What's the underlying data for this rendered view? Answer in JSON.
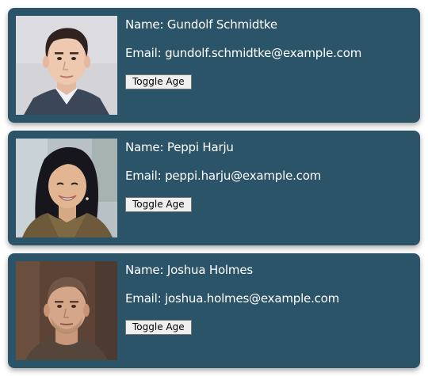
{
  "theme": {
    "card_background": "#2b5468",
    "text_color": "#ffffff"
  },
  "users": [
    {
      "name_prefix": "Name:",
      "name": "Gundolf Schmidtke",
      "email_prefix": "Email:",
      "email": "gundolf.schmidtke@example.com",
      "toggle_label": "Toggle Age",
      "photo_icon": "portrait-photo"
    },
    {
      "name_prefix": "Name:",
      "name": "Peppi Harju",
      "email_prefix": "Email:",
      "email": "peppi.harju@example.com",
      "toggle_label": "Toggle Age",
      "photo_icon": "portrait-photo"
    },
    {
      "name_prefix": "Name:",
      "name": "Joshua Holmes",
      "email_prefix": "Email:",
      "email": "joshua.holmes@example.com",
      "toggle_label": "Toggle Age",
      "photo_icon": "portrait-photo"
    }
  ]
}
